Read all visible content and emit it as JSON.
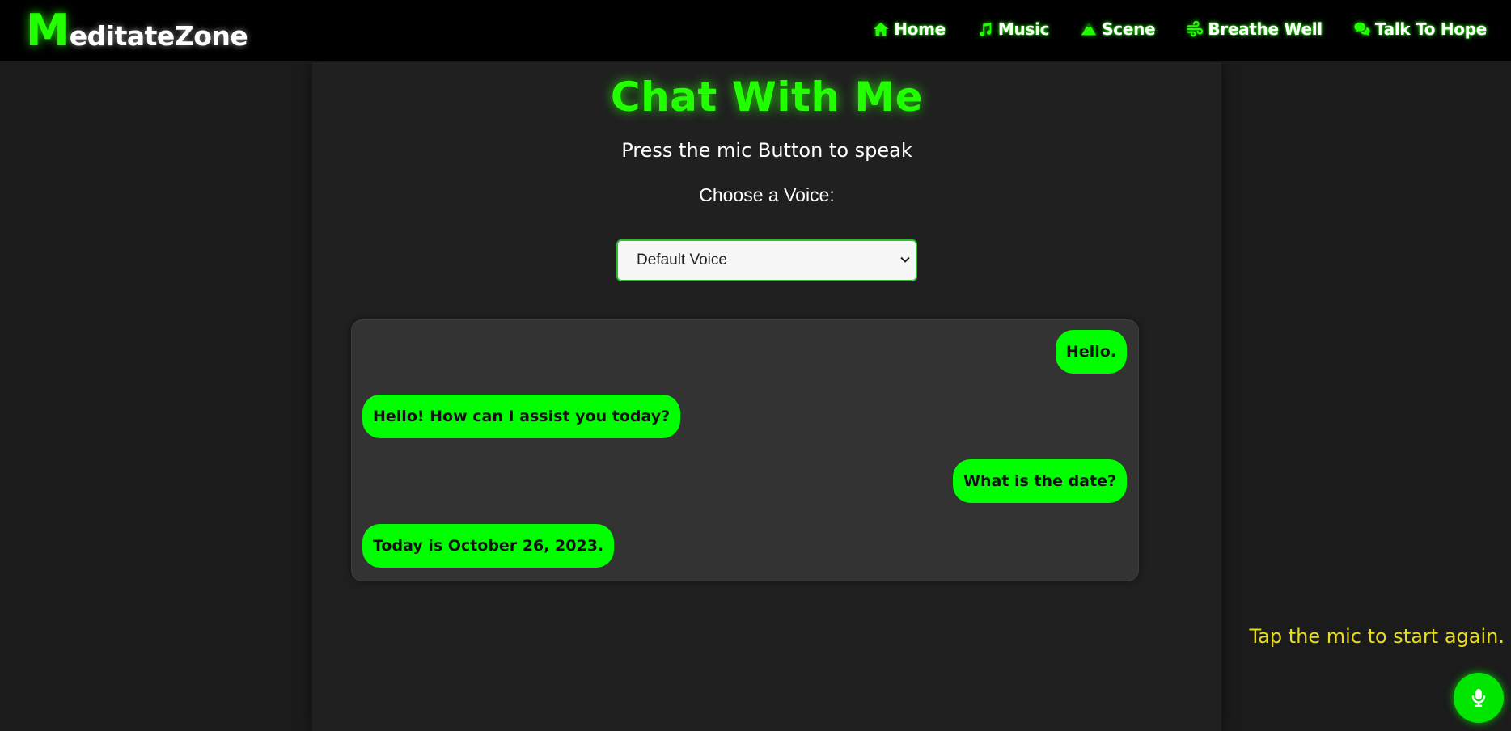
{
  "brand": {
    "first_letter": "M",
    "rest": "editateZone",
    "accent_color": "#22ff00"
  },
  "nav": {
    "items": [
      {
        "label": "Home",
        "icon": "home-icon"
      },
      {
        "label": "Music",
        "icon": "music-note-icon"
      },
      {
        "label": "Scene",
        "icon": "mountain-icon"
      },
      {
        "label": "Breathe Well",
        "icon": "wind-icon"
      },
      {
        "label": "Talk To Hope",
        "icon": "chat-bubbles-icon"
      }
    ]
  },
  "main": {
    "title": "Chat With Me",
    "subtitle": "Press the mic Button to speak",
    "voice_label": "Choose a Voice:",
    "voice_selected": "Default Voice"
  },
  "chat": {
    "messages": [
      {
        "role": "user",
        "text": "Hello."
      },
      {
        "role": "bot",
        "text": "Hello! How can I assist you today?"
      },
      {
        "role": "user",
        "text": "What is the date?"
      },
      {
        "role": "bot",
        "text": "Today is October 26, 2023."
      }
    ],
    "bubble_color": "#00ff00"
  },
  "status": {
    "text": "Tap the mic to start again.",
    "color": "#e8dc1e"
  },
  "mic": {
    "icon": "microphone-icon"
  }
}
